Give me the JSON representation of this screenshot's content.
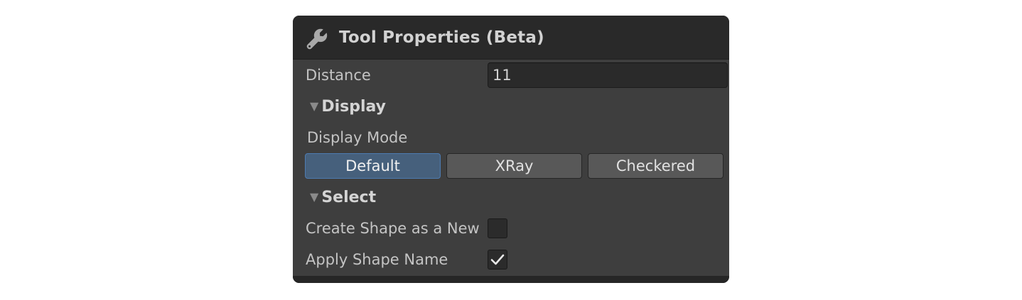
{
  "header": {
    "title": "Tool Properties (Beta)",
    "icon": "wrench-icon"
  },
  "distance": {
    "label": "Distance",
    "value": "11"
  },
  "display_section": {
    "title": "Display",
    "mode_label": "Display Mode",
    "modes": [
      "Default",
      "XRay",
      "Checkered"
    ],
    "selected": "Default"
  },
  "select_section": {
    "title": "Select",
    "create_shape_label": "Create Shape as a New",
    "create_shape_checked": false,
    "apply_name_label": "Apply Shape Name",
    "apply_name_checked": true
  },
  "colors": {
    "panel_bg": "#3e3e3e",
    "header_bg": "#292929",
    "active_button": "#46607c",
    "active_border": "#4d7bb1"
  }
}
